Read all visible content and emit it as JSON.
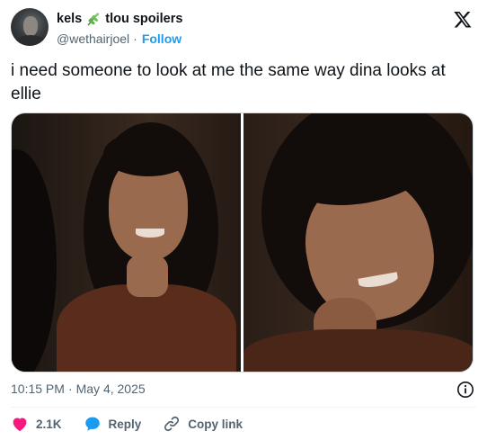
{
  "author": {
    "name_part1": "kels",
    "name_part2": "tlou spoilers",
    "handle": "@wethairjoel",
    "separator": "·",
    "follow_label": "Follow"
  },
  "tweet": {
    "text": "i need someone to look at me the same way dina looks at ellie"
  },
  "meta": {
    "time": "10:15 PM",
    "separator": "·",
    "date": "May 4, 2025"
  },
  "actions": {
    "like_count": "2.1K",
    "reply_label": "Reply",
    "copy_label": "Copy link"
  },
  "icons": {
    "brand": "x-logo-icon",
    "name_emoji": "herb-leaf-icon",
    "info": "info-icon",
    "like": "heart-icon",
    "reply": "speech-bubble-icon",
    "copy": "link-icon"
  },
  "colors": {
    "accent": "#1d9bf0",
    "like": "#f91880",
    "secondary_text": "#536471",
    "primary_text": "#0f1419"
  }
}
